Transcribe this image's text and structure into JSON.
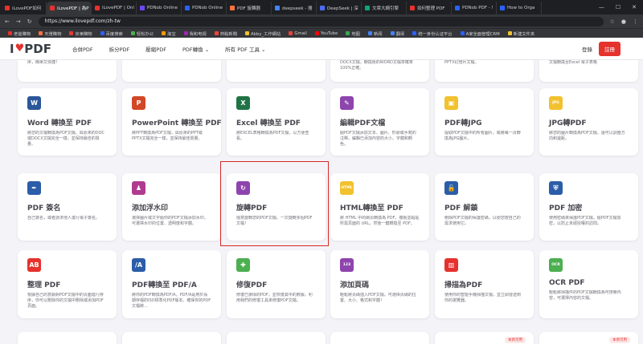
{
  "browser": {
    "tabs": [
      {
        "label": "iLovePDF如何",
        "color": "#e5322d"
      },
      {
        "label": "iLovePDF | 為P",
        "color": "#e5322d"
      },
      {
        "label": "iLovePDF | Onl",
        "color": "#e5322d"
      },
      {
        "label": "PDNob Online",
        "color": "#6c47ff"
      },
      {
        "label": "PDNob Online",
        "color": "#2962ff"
      },
      {
        "label": "PDF 旋轉器",
        "color": "#ff7043"
      },
      {
        "label": "deepseek - 搜",
        "color": "#4285f4"
      },
      {
        "label": "DeepSeek | 深",
        "color": "#4d6bfe"
      },
      {
        "label": "文章大綱引擎",
        "color": "#10a37f"
      },
      {
        "label": "如何整理 PDF",
        "color": "#e5322d"
      },
      {
        "label": "PDNob PDF - !",
        "color": "#2962ff"
      },
      {
        "label": "How to Orga",
        "color": "#2962ff"
      }
    ],
    "url": "https://www.ilovepdf.com/zh-tw",
    "bookmarks": [
      "老爸購物",
      "天燈購物",
      "京東購物",
      "百度搜索",
      "轻松办公",
      "淘宝",
      "我和电视",
      "熱點新聞",
      "Abby_工作網站",
      "Gmail",
      "YouTube",
      "地图",
      "新闻",
      "翻译",
      "统一身份认证平台",
      "A家全面管理CRM",
      "新建文件夹"
    ]
  },
  "header": {
    "logo_text": "I PDF",
    "logo_i": "I",
    "logo_pdf": "PDF",
    "heart": "♥",
    "nav": [
      "合併PDF",
      "拆分PDF",
      "壓縮PDF",
      "PDF轉換 ⌄",
      "所有 PDF 工具 ⌄"
    ],
    "login": "登錄",
    "signup": "註冊"
  },
  "top_row": [
    "序，簡單又快捷！",
    "",
    "",
    "DOCX文檔，轉換後的WORD文檔準確率100%正確。",
    "PPTX幻燈片文檔。",
    "文檔轉換至Excel 電子表格"
  ],
  "cards": [
    {
      "title": "Word 轉換至 PDF",
      "desc": "將您的文檔轉換為PDF文檔，與原來的DOC或DOCX文檔完全一樣，並保持最佳的質量。",
      "icon": "W",
      "color": "#2b579a"
    },
    {
      "title": "PowerPoint 轉換至 PDF",
      "desc": "將PPT轉換為PDF文檔，與原來的PPT或PPTX文檔完全一樣，並保持最佳質量。",
      "icon": "P",
      "color": "#d24726"
    },
    {
      "title": "Excel 轉換至 PDF",
      "desc": "將EXCEL表格轉換為PDF文檔，以方便查看。",
      "icon": "X",
      "color": "#217346"
    },
    {
      "title": "編輯PDF文檔",
      "desc": "給PDF文檔添加文本、圖片、形狀或手寫的注釋。編輯已添加內容的大小、字體和顏色。",
      "icon": "✎",
      "color": "#8e44ad"
    },
    {
      "title": "PDF轉JPG",
      "desc": "提取PDF文檔中的所有圖片，或將每一頁轉換為JPG圖片。",
      "icon": "▣",
      "color": "#f2c12e"
    },
    {
      "title": "JPG轉PDF",
      "desc": "將您的圖片轉換為PDF文檔，還可以調整方向和邊距。",
      "icon": "JPG",
      "color": "#f2c12e"
    },
    {
      "title": "PDF 簽名",
      "desc": "自己簽名，或者請求他人進行電子簽名。",
      "icon": "✒",
      "color": "#2b5da8"
    },
    {
      "title": "添加浮水印",
      "desc": "選擇圖片或文字給你的PDF文檔添加水印。可選擇水印的位置、透明度和字體。",
      "icon": "♟",
      "color": "#b03a8f"
    },
    {
      "title": "旋轉PDF",
      "desc": "隨意旋轉您的PDF文檔。一次旋轉多個PDF文檔！",
      "icon": "↻",
      "color": "#8e44ad"
    },
    {
      "title": "HTML轉換至 PDF",
      "desc": "將 HTML 中的網頁轉換為 PDF，複製並黏貼所需頁面的 URL，然後一鍵轉換至 PDF。",
      "icon": "HTML",
      "color": "#f2c12e"
    },
    {
      "title": "PDF 解鎖",
      "desc": "刪除PDF文檔的保護密碼，以便您按自己的需求使用它。",
      "icon": "🔓",
      "color": "#2b5da8"
    },
    {
      "title": "PDF 加密",
      "desc": "使用密碼來保護PDF文檔。給PDF文檔加密，以防止未經授權的訪問。",
      "icon": "⛨",
      "color": "#2b5da8"
    },
    {
      "title": "整理 PDF",
      "desc": "根據自己的意願對PDF文檔中的頁面進行排序，你可以刪除你的文檔中刪除或添加PDF頁面。",
      "icon": "AB",
      "color": "#e5322d"
    },
    {
      "title": "PDF轉換至 PDF/A",
      "desc": "將你的PDF轉換為PDF/A，PDF/A是用於長期存檔的ISO標準化PDF版本。確保你的PDF文檔將...",
      "icon": "/A",
      "color": "#2b5da8"
    },
    {
      "title": "修復PDF",
      "desc": "修復已損壞的PDF，並恢復其中的數據。利用我們的修復工具來修復PDF文檔。",
      "icon": "✚",
      "color": "#4caf50"
    },
    {
      "title": "添加頁碼",
      "desc": "輕鬆將頁碼插入PDF文檔。可選擇頁碼的位置、大小、格式和字體！",
      "icon": "123",
      "color": "#8e44ad"
    },
    {
      "title": "掃描為PDF",
      "desc": "使用你的智能手機掃描文檔，並立即發送到你的瀏覽器。",
      "icon": "▥",
      "color": "#e5322d"
    },
    {
      "title": "OCR PDF",
      "desc": "輕鬆將掃描件的PDF文檔轉換為可搜索內容，可選擇內容的文檔。",
      "icon": "OCR",
      "color": "#4caf50"
    }
  ],
  "bottom_badges": [
    "",
    "",
    "",
    "",
    "本頁可用",
    "本頁可用"
  ]
}
